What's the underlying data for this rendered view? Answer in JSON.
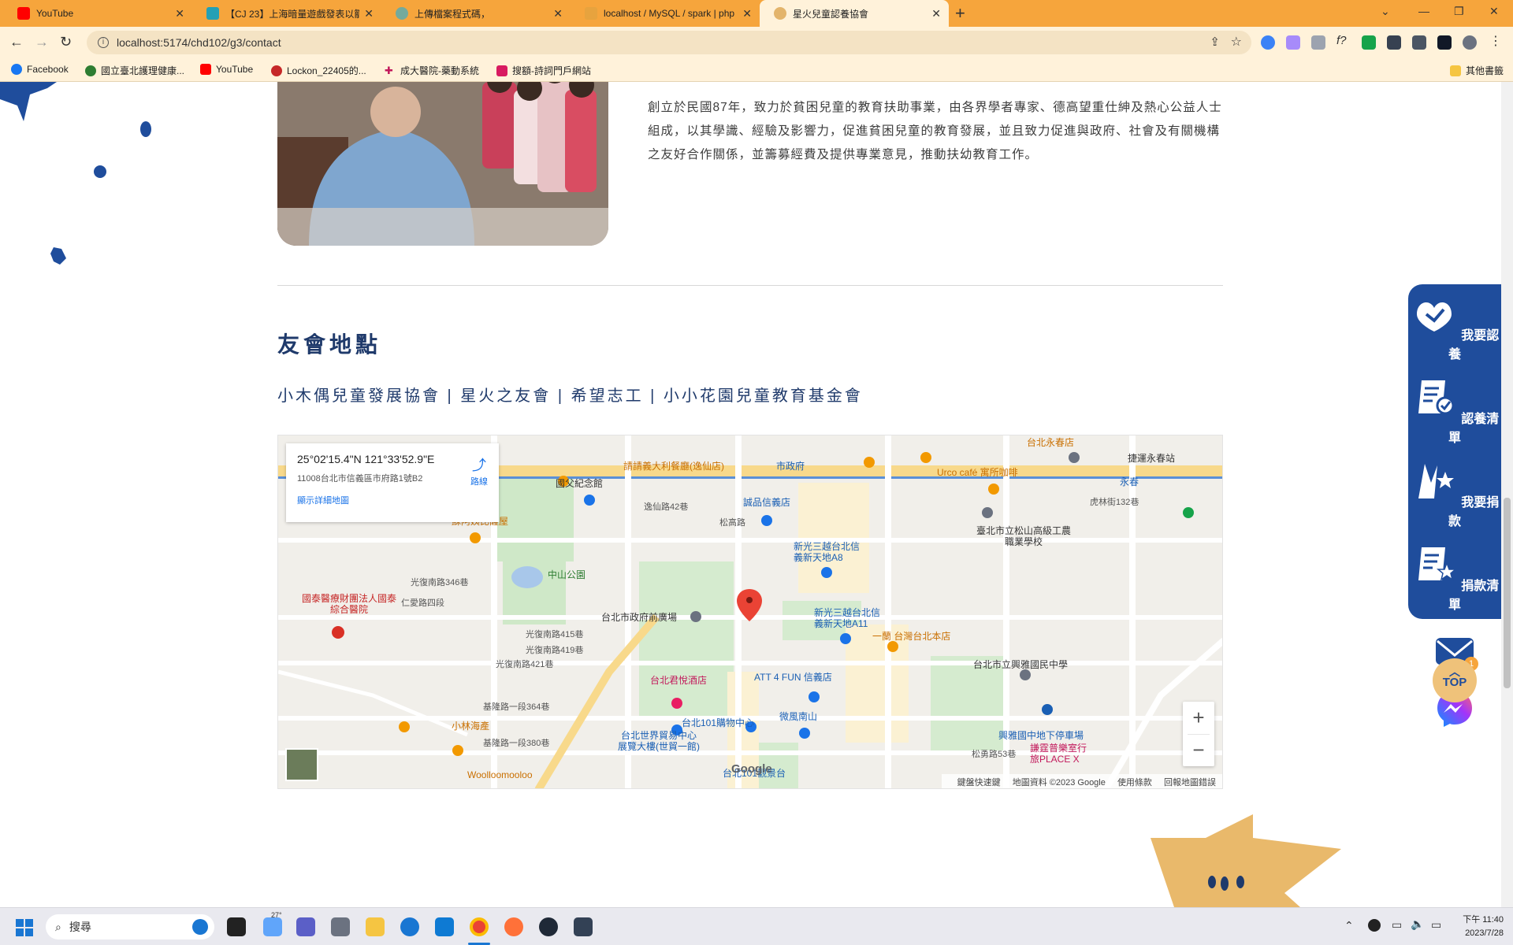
{
  "browser": {
    "tabs": [
      {
        "title": "YouTube",
        "color": "#ff0000",
        "active": false
      },
      {
        "title": "【CJ 23】上海暗量遊戲發表以籠",
        "color": "#24a0b5",
        "active": false
      },
      {
        "title": "上傳檔案程式碼，",
        "color": "#74aa9c",
        "active": false
      },
      {
        "title": "localhost / MySQL / spark | php",
        "color": "#e7a33e",
        "active": false
      },
      {
        "title": "星火兒童認養協會",
        "color": "#e3b46b",
        "active": true
      }
    ],
    "address": "localhost:5174/chd102/g3/contact",
    "bookmarks": [
      {
        "label": "Facebook",
        "color": "#1877f2"
      },
      {
        "label": "國立臺北護理健康...",
        "color": "#2e7d32"
      },
      {
        "label": "YouTube",
        "color": "#ff0000"
      },
      {
        "label": "Lockon_22405的...",
        "color": "#c62828"
      },
      {
        "label": "成大醫院-藥動系統",
        "color": "#c2185b"
      },
      {
        "label": "搜額-詩詞門戶網站",
        "color": "#d81b60"
      }
    ],
    "other_bookmarks": "其他書籤"
  },
  "about": {
    "text": "創立於民國87年，致力於貧困兒童的教育扶助事業，由各界學者專家、德高望重仕紳及熱心公益人士組成，以其學識、經驗及影響力，促進貧困兒童的教育發展，並且致力促進與政府、社會及有關機構之友好合作關係，並籌募經費及提供專業意見，推動扶幼教育工作。"
  },
  "section": {
    "title": "友會地點",
    "subtitle": "小木偶兒童發展協會 | 星火之友會 | 希望志工 | 小小花園兒童教育基金會"
  },
  "map": {
    "coordinates": "25°02'15.4\"N 121°33'52.9\"E",
    "address": "11008台北市信義區市府路1號B2",
    "route": "路線",
    "more": "顯示詳細地圖",
    "zoom_in": "+",
    "zoom_out": "−",
    "google": "Google",
    "footer": [
      "鍵盤快速鍵",
      "地圖資料 ©2023 Google",
      "使用條款",
      "回報地圖錯誤"
    ],
    "labels": [
      {
        "text": "國父紀念館",
        "style": "lbl-dark"
      },
      {
        "text": "市政府",
        "style": "lbl-blue"
      },
      {
        "text": "誠品信義店",
        "style": "lbl-blue"
      },
      {
        "text": "中山公園",
        "style": "lbl-green"
      },
      {
        "text": "台北市政府前廣場",
        "style": "lbl-dark"
      },
      {
        "text": "新光三越台北信義新天地A8",
        "style": "lbl-blue"
      },
      {
        "text": "新光三越台北信義新天地A11",
        "style": "lbl-blue"
      },
      {
        "text": "一蘭 台灣台北本店",
        "style": "lbl-orange"
      },
      {
        "text": "臺北市立松山高級工農職業學校",
        "style": "lbl-dark"
      },
      {
        "text": "台北市立興雅國民中學",
        "style": "lbl-dark"
      },
      {
        "text": "國泰醫療財團法人國泰綜合醫院",
        "style": "lbl-red"
      },
      {
        "text": "台北君悅酒店",
        "style": "lbl-pink"
      },
      {
        "text": "ATT 4 FUN 信義店",
        "style": "lbl-blue"
      },
      {
        "text": "台北101購物中心",
        "style": "lbl-blue"
      },
      {
        "text": "微風南山",
        "style": "lbl-blue"
      },
      {
        "text": "台北世界貿易中心展覽大樓(世貿一館)",
        "style": "lbl-blue"
      },
      {
        "text": "台北101觀景台",
        "style": "lbl-blue"
      },
      {
        "text": "興雅國中地下停車場",
        "style": "lbl-blue"
      },
      {
        "text": "謙霆普樂室行旅PLACE X",
        "style": "lbl-pink"
      },
      {
        "text": "Woolloomooloo",
        "style": "lbl-orange"
      },
      {
        "text": "小林海產",
        "style": "lbl-orange"
      },
      {
        "text": "蘇阿姨比薩屋",
        "style": "lbl-orange"
      },
      {
        "text": "請請義大利餐廳(逸仙店)",
        "style": "lbl-orange"
      },
      {
        "text": "Urco café 寓所咖啡",
        "style": "lbl-orange"
      },
      {
        "text": "捷運永春站",
        "style": "lbl-dark"
      },
      {
        "text": "永春",
        "style": "lbl-blue"
      },
      {
        "text": "台北永春店",
        "style": "lbl-orange"
      },
      {
        "text": "松高路",
        "style": "lbl-gray"
      },
      {
        "text": "仁愛路四段",
        "style": "lbl-gray"
      },
      {
        "text": "光復南路415巷",
        "style": "lbl-gray"
      },
      {
        "text": "光復南路419巷",
        "style": "lbl-gray"
      },
      {
        "text": "光復南路421巷",
        "style": "lbl-gray"
      },
      {
        "text": "光復南路346巷",
        "style": "lbl-gray"
      },
      {
        "text": "基隆路一段364巷",
        "style": "lbl-gray"
      },
      {
        "text": "基隆路一段380巷",
        "style": "lbl-gray"
      },
      {
        "text": "逸仙路42巷",
        "style": "lbl-gray"
      },
      {
        "text": "虎林街132巷",
        "style": "lbl-gray"
      },
      {
        "text": "松勇路53巷",
        "style": "lbl-gray"
      }
    ]
  },
  "side_menu": [
    {
      "label": "我要認養",
      "icon": "heart-hand-icon"
    },
    {
      "label": "認養清單",
      "icon": "checklist-icon"
    },
    {
      "label": "我要捐款",
      "icon": "donate-star-icon"
    },
    {
      "label": "捐款清單",
      "icon": "donation-list-icon"
    }
  ],
  "mail_badge": "1",
  "top_label": "TOP",
  "taskbar": {
    "search_placeholder": "搜尋",
    "weather": "27°",
    "time": "下午 11:40",
    "date": "2023/7/28"
  }
}
